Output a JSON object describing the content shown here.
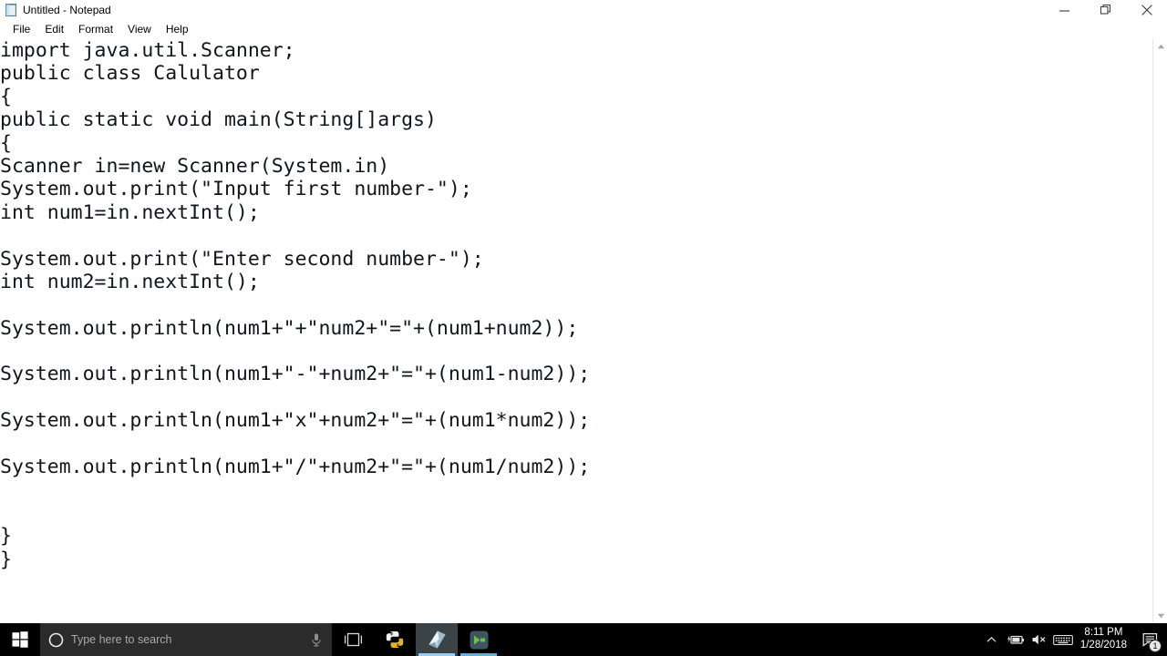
{
  "window": {
    "title": "Untitled - Notepad",
    "icon": "notepad-document-icon",
    "controls": {
      "minimize": "Minimize",
      "restore": "Restore Down",
      "close": "Close"
    }
  },
  "menu": {
    "items": [
      {
        "label": "File"
      },
      {
        "label": "Edit"
      },
      {
        "label": "Format"
      },
      {
        "label": "View"
      },
      {
        "label": "Help"
      }
    ]
  },
  "editor": {
    "lines": [
      "import java.util.Scanner;",
      "public class Calulator",
      "{",
      "public static void main(String[]args)",
      "{",
      "Scanner in=new Scanner(System.in)",
      "System.out.print(\"Input first number-\");",
      "int num1=in.nextInt();",
      "",
      "System.out.print(\"Enter second number-\");",
      "int num2=in.nextInt();",
      "",
      "System.out.println(num1+\"+\"num2+\"=\"+(num1+num2));",
      "",
      "System.out.println(num1+\"-\"+num2+\"=\"+(num1-num2));",
      "",
      "System.out.println(num1+\"x\"+num2+\"=\"+(num1*num2));",
      "",
      "System.out.println(num1+\"/\"+num2+\"=\"+(num1/num2));",
      "",
      "",
      "}",
      "}"
    ],
    "text_color": "#11161e",
    "background_color": "#ffffff"
  },
  "scrollbar": {
    "up_arrow": "scroll-up-arrow-icon",
    "down_arrow": "scroll-down-arrow-icon"
  },
  "taskbar": {
    "background_color": "#000000",
    "start": {
      "name": "start-button"
    },
    "search": {
      "placeholder": "Type here to search",
      "cortana_icon": "cortana-circle-icon",
      "mic_icon": "microphone-icon",
      "background_color": "#2b2b2b"
    },
    "task_view": {
      "label": "Task View",
      "icon": "task-view-icon"
    },
    "apps": [
      {
        "name": "python-idle",
        "icon": "python-icon",
        "active": false,
        "running": false
      },
      {
        "name": "notepad",
        "icon": "notepad-icon",
        "active": true,
        "running": true
      },
      {
        "name": "command-prompt",
        "icon": "terminal-icon",
        "active": false,
        "running": true
      }
    ],
    "tray": {
      "chevron": "chevron-up-icon",
      "battery": "battery-charging-icon",
      "volume": "speaker-muted-icon",
      "keyboard": "keyboard-icon",
      "time": "8:11 PM",
      "date": "1/28/2018",
      "notification_icon": "notification-icon",
      "notification_count": "1",
      "accent_color": "#5fb0e8"
    }
  }
}
